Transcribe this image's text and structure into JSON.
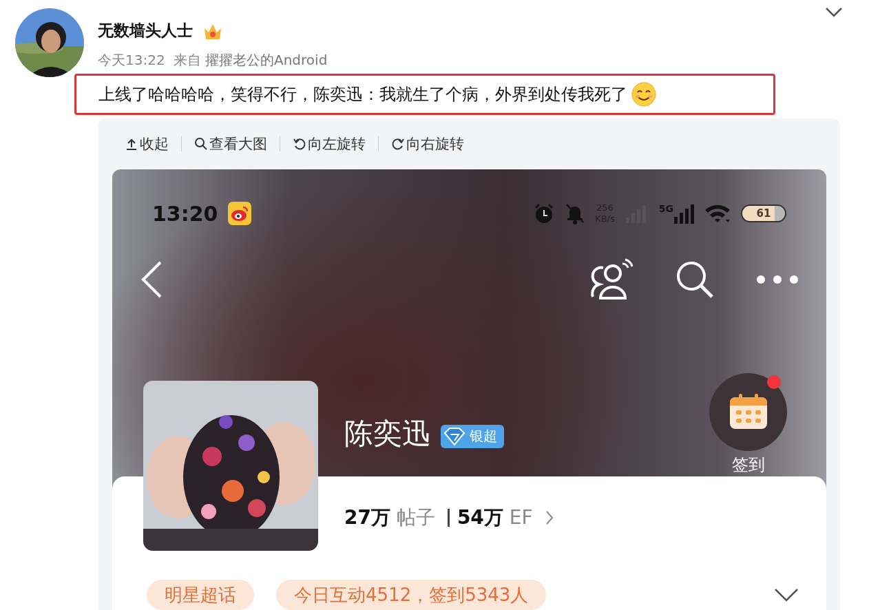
{
  "post": {
    "author": "无数墙头人士",
    "time": "今天13:22",
    "source_prefix": "来自",
    "source": "擢擢老公的Android",
    "text": "上线了哈哈哈哈，笑得不行，陈奕迅：我就生了个病，外界到处传我死了",
    "highlighted": true
  },
  "toolbar": [
    {
      "label": "收起",
      "kind": "collapse"
    },
    {
      "label": "查看大图",
      "kind": "zoom"
    },
    {
      "label": "向左旋转",
      "kind": "rotate-left"
    },
    {
      "label": "向右旋转",
      "kind": "rotate-right"
    }
  ],
  "phone": {
    "status_bar": {
      "time": "13:20",
      "net_speed": "256",
      "net_speed_unit": "KB/s",
      "network": "5G",
      "battery": "61"
    },
    "profile": {
      "name": "陈奕迅",
      "badge": "银超",
      "checkin": "签到",
      "stats": [
        "**27万** 帖子",
        "**54万** EF"
      ],
      "tags": [
        "明星超话",
        "今日互动4512，签到5343人"
      ]
    }
  }
}
